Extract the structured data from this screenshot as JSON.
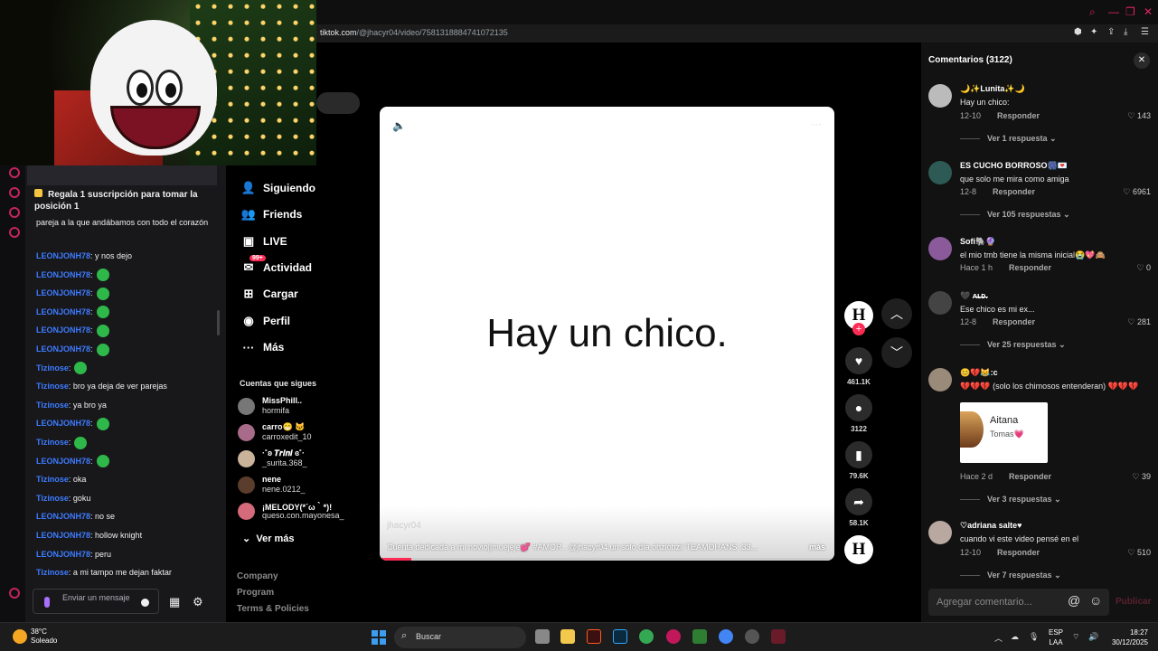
{
  "browser": {
    "url_domain": "tiktok.com",
    "url_path": "/@jhacyr04/video/7581318884741072135"
  },
  "stream_chat": {
    "sub_banner": "Regala 1 suscripción para tomar la posición 1",
    "messages": [
      {
        "user": "",
        "text": "pareja a la que andábamos con todo el corazón",
        "user_color": "#efeff1",
        "emote": false
      },
      {
        "user": "LEONJONH78",
        "text": ": y nos dejo",
        "user_color": "#3d7bff",
        "emote": false
      },
      {
        "user": "LEONJONH78",
        "text": ":",
        "user_color": "#3d7bff",
        "emote": true
      },
      {
        "user": "LEONJONH78",
        "text": ":",
        "user_color": "#3d7bff",
        "emote": true
      },
      {
        "user": "LEONJONH78",
        "text": ":",
        "user_color": "#3d7bff",
        "emote": true
      },
      {
        "user": "LEONJONH78",
        "text": ":",
        "user_color": "#3d7bff",
        "emote": true
      },
      {
        "user": "LEONJONH78",
        "text": ":",
        "user_color": "#3d7bff",
        "emote": true
      },
      {
        "user": "Tizinose",
        "text": ":",
        "user_color": "#3d7bff",
        "emote": true
      },
      {
        "user": "Tizinose",
        "text": ": bro ya deja de ver parejas",
        "user_color": "#3d7bff",
        "emote": false
      },
      {
        "user": "Tizinose",
        "text": ": ya bro ya",
        "user_color": "#3d7bff",
        "emote": false
      },
      {
        "user": "LEONJONH78",
        "text": ":",
        "user_color": "#3d7bff",
        "emote": true
      },
      {
        "user": "Tizinose",
        "text": ":",
        "user_color": "#3d7bff",
        "emote": true
      },
      {
        "user": "LEONJONH78",
        "text": ":",
        "user_color": "#3d7bff",
        "emote": true
      },
      {
        "user": "Tizinose",
        "text": ": oka",
        "user_color": "#3d7bff",
        "emote": false
      },
      {
        "user": "Tizinose",
        "text": ": goku",
        "user_color": "#3d7bff",
        "emote": false
      },
      {
        "user": "LEONJONH78",
        "text": ": no se",
        "user_color": "#3d7bff",
        "emote": false
      },
      {
        "user": "LEONJONH78",
        "text": ": hollow knight",
        "user_color": "#3d7bff",
        "emote": false
      },
      {
        "user": "LEONJONH78",
        "text": ": peru",
        "user_color": "#3d7bff",
        "emote": false
      },
      {
        "user": "Tizinose",
        "text": ": a mi tampo me dejan faktar",
        "user_color": "#3d7bff",
        "emote": false
      }
    ],
    "input_placeholder": "Enviar un mensaje"
  },
  "tiktok_nav": {
    "items": [
      {
        "label": "Siguiendo",
        "icon": "user-follow-icon"
      },
      {
        "label": "Friends",
        "icon": "friends-icon"
      },
      {
        "label": "LIVE",
        "icon": "live-icon"
      },
      {
        "label": "Actividad",
        "icon": "activity-icon",
        "badge": "99+"
      },
      {
        "label": "Cargar",
        "icon": "upload-icon"
      },
      {
        "label": "Perfil",
        "icon": "profile-icon"
      },
      {
        "label": "Más",
        "icon": "more-icon"
      }
    ],
    "following_title": "Cuentas que sigues",
    "following": [
      {
        "name": "MissPhill..",
        "handle": "hormifa"
      },
      {
        "name": "carro😁 🐱",
        "handle": "carroxedit_10"
      },
      {
        "name": "·˚ʚ 𝑻𝒓𝒊𝒏𝒊 ɞ˚·",
        "handle": "_surita.368_"
      },
      {
        "name": "nene",
        "handle": "nene.0212_"
      },
      {
        "name": "¡MELODY(*´ω｀*)!",
        "handle": "queso.con.mayonesa_"
      }
    ],
    "see_more": "Ver más",
    "footer": [
      "Company",
      "Program",
      "Terms & Policies"
    ]
  },
  "video": {
    "caption": "Hay un chico.",
    "watermark": "jhacyr04",
    "description": "Cuenta dedicada a mi novio||muejeje💕 #AMOR . @jhacyr04 un solo día ohziohzii TEAMOHANS :33...",
    "more": "más",
    "progress": 0.07,
    "author_initial": "H",
    "actions": {
      "likes": "461.1K",
      "comments": "3122",
      "saves": "79.6K",
      "shares": "58.1K"
    }
  },
  "comments_panel": {
    "title": "Comentarios (3122)",
    "items": [
      {
        "name": "🌙✨Lunita✨🌙",
        "text": "Hay un chico:",
        "date": "12-10",
        "reply": "Responder",
        "likes": "143",
        "replies": "Ver 1 respuesta"
      },
      {
        "name": "ES CUCHO BORROSO🎆💌",
        "text": "que solo me mira como amiga",
        "date": "12-8",
        "reply": "Responder",
        "likes": "6961",
        "replies": "Ver 105 respuestas"
      },
      {
        "name": "Sofi🐘🔮",
        "text": "el mio tmb tiene la misma inicial😭💖🙈",
        "date": "Hace 1 h",
        "reply": "Responder",
        "likes": "0",
        "replies": ""
      },
      {
        "name": "🖤 ᴀ̶ʟ̶ᴅ̶.",
        "text": "Ese chico es mi ex...",
        "date": "12-8",
        "reply": "Responder",
        "likes": "281",
        "replies": "Ver 25 respuestas"
      },
      {
        "name": "😊💔😹:c",
        "text": "💔💔💔 (solo los chimosos entenderan) 💔💔💔",
        "date": "Hace 2 d",
        "reply": "Responder",
        "likes": "39",
        "replies": "Ver 3 respuestas",
        "thumb_title": "Aitana",
        "thumb_sub": "Tomas💗"
      },
      {
        "name": "♡adriana salte♥",
        "text": "cuando vi este video pensé en el",
        "date": "12-10",
        "reply": "Responder",
        "likes": "510",
        "replies": "Ver 7 respuestas"
      }
    ],
    "input_placeholder": "Agregar comentario...",
    "publish": "Publicar"
  },
  "taskbar": {
    "temp": "38°C",
    "weather": "Soleado",
    "search": "Buscar",
    "lang_top": "ESP",
    "lang_bottom": "LAA",
    "time": "18:27",
    "date": "30/12/2025"
  }
}
